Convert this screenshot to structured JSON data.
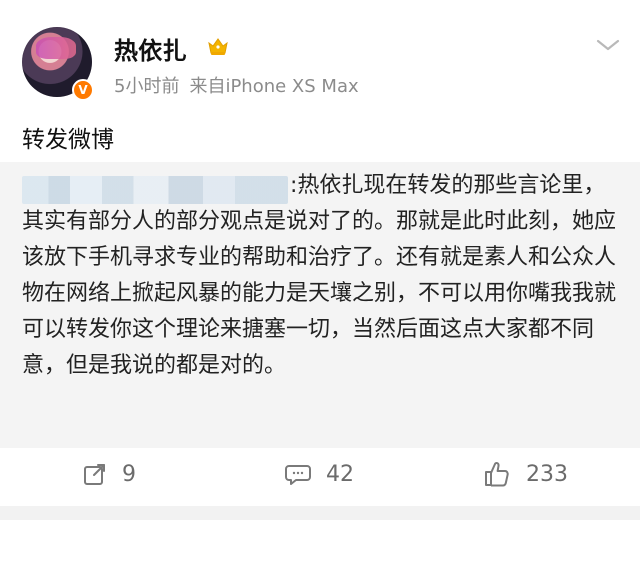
{
  "post": {
    "user": {
      "name": "热依扎",
      "verified_badge": "V",
      "crown_icon": "crown-icon",
      "avatar_icon": "avatar"
    },
    "meta": {
      "time": "5小时前",
      "source": "来自iPhone XS Max"
    },
    "caption": "转发微博",
    "repost": {
      "redacted_author": "",
      "text": ":热依扎现在转发的那些言论里，其实有部分人的部分观点是说对了的。那就是此时此刻，她应该放下手机寻求专业的帮助和治疗了。还有就是素人和公众人物在网络上掀起风暴的能力是天壤之别，不可以用你嘴我我就可以转发你这个理论来搪塞一切，当然后面这点大家都不同意，但是我说的都是对的。"
    },
    "actions": [
      {
        "name": "repost",
        "count": "9"
      },
      {
        "name": "comment",
        "count": "42"
      },
      {
        "name": "like",
        "count": "233"
      }
    ],
    "colors": {
      "accent_orange": "#ff7a00",
      "repost_bg": "#f4f4f4",
      "meta_gray": "#8b8b8b"
    }
  }
}
